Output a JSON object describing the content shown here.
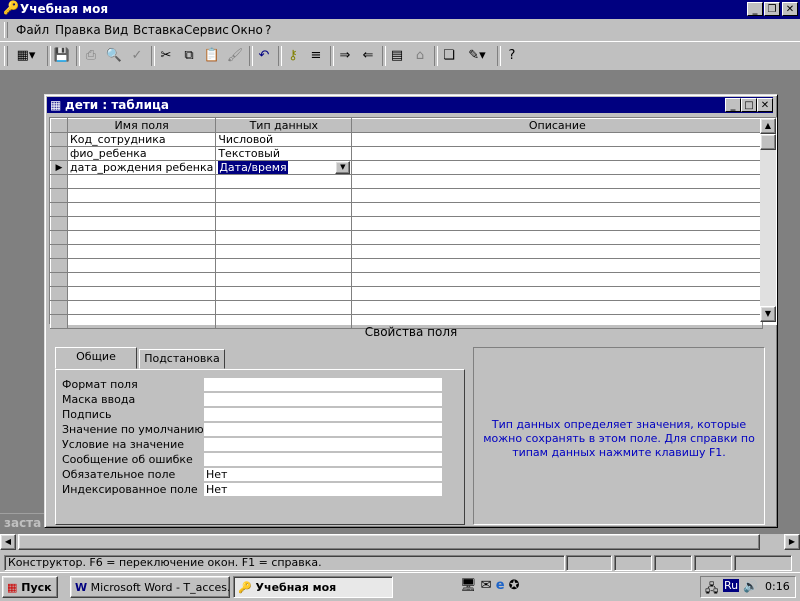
{
  "app": {
    "title": "Учебная моя",
    "icon": "key-icon",
    "controls": [
      "minimize-icon",
      "restore-icon",
      "close-icon"
    ]
  },
  "menu": [
    "Файл",
    "Правка",
    "Вид",
    "Вставка",
    "Сервис",
    "Окно",
    "?"
  ],
  "toolbar": {
    "buttons": [
      "view-icon",
      "save-icon",
      "print-icon",
      "preview-icon",
      "spell-icon",
      "cut-icon",
      "copy-icon",
      "paste-icon",
      "format-painter-icon",
      "undo-icon",
      "primary-key-icon",
      "indexes-icon",
      "insert-rows-icon",
      "delete-rows-icon",
      "properties-icon",
      "build-icon",
      "database-window-icon",
      "new-object-icon",
      "help-icon"
    ]
  },
  "background_window_fragment": "заста",
  "table_window": {
    "title": "дети : таблица",
    "columns": [
      "Имя поля",
      "Тип данных",
      "Описание"
    ],
    "rows": [
      {
        "name": "Код_сотрудника",
        "type": "Числовой",
        "description": ""
      },
      {
        "name": "фио_ребенка",
        "type": "Текстовый",
        "description": ""
      },
      {
        "name": "дата_рождения ребенка",
        "type": "Дата/время",
        "description": ""
      }
    ],
    "current_row_index": 2,
    "properties_header": "Свойства поля",
    "tabs": [
      "Общие",
      "Подстановка"
    ],
    "active_tab": "Общие",
    "properties": [
      {
        "label": "Формат поля",
        "value": ""
      },
      {
        "label": "Маска ввода",
        "value": ""
      },
      {
        "label": "Подпись",
        "value": ""
      },
      {
        "label": "Значение по умолчанию",
        "value": ""
      },
      {
        "label": "Условие на значение",
        "value": ""
      },
      {
        "label": "Сообщение об ошибке",
        "value": ""
      },
      {
        "label": "Обязательное поле",
        "value": "Нет"
      },
      {
        "label": "Индексированное поле",
        "value": "Нет"
      }
    ],
    "help_text": "Тип данных определяет значения, которые можно сохранять в этом поле.  Для справки по типам данных нажмите клавишу F1."
  },
  "status": "Конструктор.  F6 = переключение окон.  F1 = справка.",
  "taskbar": {
    "start": "Пуск",
    "tasks": [
      {
        "label": "Microsoft Word - T_acces...",
        "active": false
      },
      {
        "label": "Учебная моя",
        "active": true
      }
    ],
    "tray_lang": "Ru",
    "clock": "0:16"
  },
  "colors": {
    "title_active": "#000080",
    "face": "#c0c0c0",
    "mdi_background": "#808080",
    "help_text": "#0000c0"
  }
}
